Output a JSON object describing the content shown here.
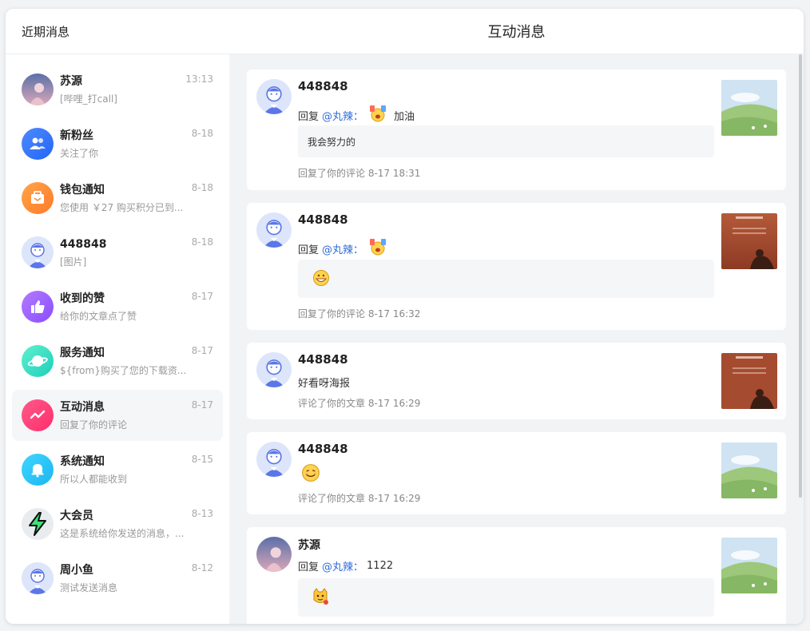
{
  "left_title": "近期消息",
  "conversations": [
    {
      "name": "苏源",
      "time": "13:13",
      "preview": "[哔哩_打call]",
      "icon": "avatar-illustration"
    },
    {
      "name": "新粉丝",
      "time": "8-18",
      "preview": "关注了你",
      "icon": "users-icon"
    },
    {
      "name": "钱包通知",
      "time": "8-18",
      "preview": "您使用 ￥27 购买积分已到...",
      "icon": "wallet-icon"
    },
    {
      "name": "448848",
      "time": "8-18",
      "preview": "[图片]",
      "icon": "avatar-cartoon"
    },
    {
      "name": "收到的赞",
      "time": "8-17",
      "preview": "给你的文章点了赞",
      "icon": "thumbs-up-icon"
    },
    {
      "name": "服务通知",
      "time": "8-17",
      "preview": "${from}购买了您的下载资...",
      "icon": "planet-icon"
    },
    {
      "name": "互动消息",
      "time": "8-17",
      "preview": "回复了你的评论",
      "icon": "interaction-icon"
    },
    {
      "name": "系统通知",
      "time": "8-15",
      "preview": "所以人都能收到",
      "icon": "bell-icon"
    },
    {
      "name": "大会员",
      "time": "8-13",
      "preview": "这是系统给你发送的消息，...",
      "icon": "lightning-icon"
    },
    {
      "name": "周小鱼",
      "time": "8-12",
      "preview": "测试发送消息",
      "icon": "avatar-cartoon"
    }
  ],
  "right_title": "互动消息",
  "messages": [
    {
      "user": "448848",
      "reply_prefix": "回复",
      "mention": "@丸辣：",
      "text": "加油",
      "quote": "我会努力的",
      "meta": "回复了你的评论 8-17 18:31",
      "thumb": "meadow"
    },
    {
      "user": "448848",
      "reply_prefix": "回复",
      "mention": "@丸辣：",
      "text": "",
      "quote": "",
      "meta": "回复了你的评论 8-17 16:32",
      "thumb": "sunset"
    },
    {
      "user": "448848",
      "text": "好看呀海报",
      "meta": "评论了你的文章 8-17 16:29",
      "thumb": "sunset"
    },
    {
      "user": "448848",
      "text": "",
      "meta": "评论了你的文章 8-17 16:29",
      "thumb": "meadow"
    },
    {
      "user": "苏源",
      "reply_prefix": "回复",
      "mention": "@丸辣：",
      "text": "1122",
      "quote": "",
      "meta": "",
      "thumb": "meadow"
    }
  ],
  "colors": {
    "accent_link": "#2f6bd8",
    "active_bg": "#f5f6f7"
  }
}
